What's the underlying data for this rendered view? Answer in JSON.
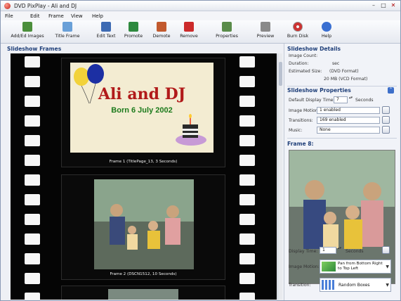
{
  "window": {
    "title": "DVD PixPlay - Ali and DJ",
    "controls": {
      "minimize": "–",
      "maximize": "□",
      "close": "✕"
    }
  },
  "menu": [
    "File",
    "Edit",
    "Frame",
    "View",
    "Help"
  ],
  "toolbar": [
    {
      "label": "Add/Ed Images",
      "icon": "add-images-icon"
    },
    {
      "label": "Title Frame",
      "icon": "title-frame-icon"
    },
    {
      "label": "Edit Text",
      "icon": "edit-text-icon"
    },
    {
      "label": "Promote",
      "icon": "promote-icon"
    },
    {
      "label": "Demote",
      "icon": "demote-icon"
    },
    {
      "label": "Remove",
      "icon": "remove-icon"
    },
    {
      "label": "Properties",
      "icon": "properties-icon"
    },
    {
      "label": "Preview",
      "icon": "preview-icon"
    },
    {
      "label": "Burn Disk",
      "icon": "burn-disk-icon"
    },
    {
      "label": "Help",
      "icon": "help-icon"
    }
  ],
  "left": {
    "section_title": "Slideshow Frames",
    "frames": [
      {
        "title_text": "Ali and DJ",
        "subtitle_text": "Born 6 July 2002",
        "caption": "Frame 1 (TitlePage_13, 3 Seconds)"
      },
      {
        "caption": "Frame 2 (DSCN1512, 10 Seconds)"
      }
    ]
  },
  "right": {
    "details_title": "Slideshow Details",
    "details": [
      {
        "label": "Image Count:",
        "value": ""
      },
      {
        "label": "Duration:",
        "value": "sec"
      },
      {
        "label": "Estimated Size:",
        "value": "(DVD Format)"
      },
      {
        "label": "",
        "value": "20 MB (VCD Format)"
      }
    ],
    "properties_title": "Slideshow Properties",
    "default_display_label": "Default Display Time:",
    "default_display_value": "7",
    "default_display_unit": "Seconds",
    "image_motion_label": "Image Motion:",
    "image_motion_value": "1 enabled",
    "transitions_label": "Transitions:",
    "transitions_value": "169 enabled",
    "music_label": "Music:",
    "music_value": "None",
    "frame_title": "Frame 8:",
    "display_time_label": "Display Time:",
    "display_time_value": "1",
    "display_time_unit": "Seconds",
    "frame_motion_label": "Image Motion:",
    "frame_motion_value": "Pan from Bottom Right to Top Left",
    "frame_transition_label": "Transition:",
    "frame_transition_value": "Random Boxes"
  },
  "colors": {
    "section_title": "#1f3f79",
    "title_text": "#b11a1a",
    "subtitle_text": "#1b7a1b"
  }
}
